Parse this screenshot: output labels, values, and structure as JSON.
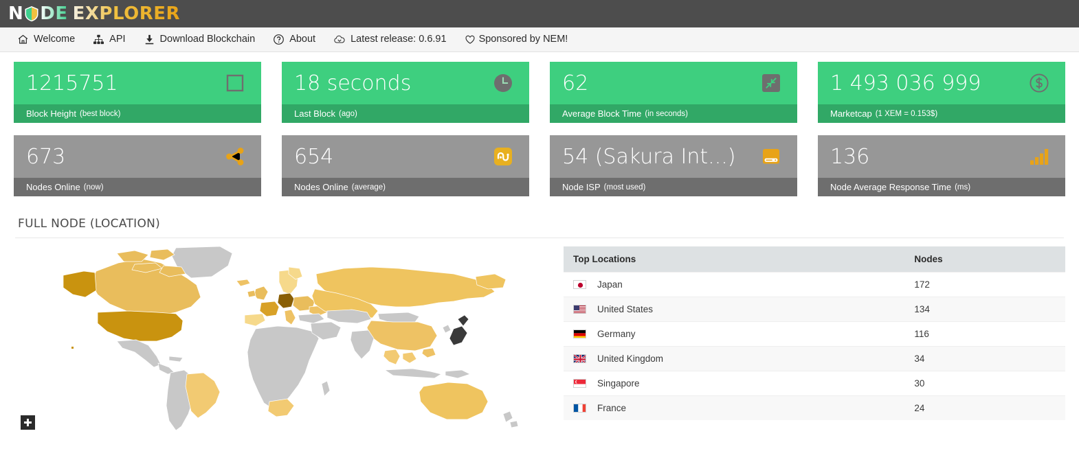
{
  "brand": {
    "part1": "N",
    "logo_icon": "nem-shield-icon",
    "part2": "DE",
    "part3": "EXPLORER"
  },
  "nav": {
    "items": [
      {
        "icon": "home-icon",
        "label": "Welcome"
      },
      {
        "icon": "sitemap-icon",
        "label": "API"
      },
      {
        "icon": "download-icon",
        "label": "Download Blockchain"
      },
      {
        "icon": "question-circle-icon",
        "label": "About"
      },
      {
        "icon": "cloud-download-icon",
        "label": "Latest release: 0.6.91"
      },
      {
        "icon": "heart-icon",
        "label": "Sponsored by NEM!"
      }
    ]
  },
  "colors": {
    "header_bg": "#4d4d4d",
    "nav_bg": "#f5f5f5",
    "green_body": "#3ecf7f",
    "green_footer": "#31a866",
    "gray_body": "#979797",
    "gray_footer": "#6e6e6e",
    "accent_gold": "#e8a317",
    "table_header_bg": "#dde1e3"
  },
  "cards": [
    {
      "value": "1215751",
      "label": "Block Height",
      "sub": "(best block)",
      "icon": "cube-icon",
      "theme": "green"
    },
    {
      "value": "18 seconds",
      "label": "Last Block",
      "sub": "(ago)",
      "icon": "clock-icon",
      "theme": "green"
    },
    {
      "value": "62",
      "label": "Average Block Time",
      "sub": "(in seconds)",
      "icon": "compress-icon",
      "theme": "green"
    },
    {
      "value": "1 493 036 999",
      "label": "Marketcap",
      "sub": "(1 XEM = 0.153$)",
      "icon": "dollar-icon",
      "theme": "green"
    },
    {
      "value": "673",
      "label": "Nodes Online",
      "sub": "(now)",
      "icon": "share-icon",
      "theme": "gray"
    },
    {
      "value": "654",
      "label": "Nodes Online",
      "sub": "(average)",
      "icon": "stumbleupon-icon",
      "theme": "gray"
    },
    {
      "value": "54 (Sakura Int...)",
      "label": "Node ISP",
      "sub": "(most used)",
      "icon": "hdd-icon",
      "theme": "gray"
    },
    {
      "value": "136",
      "label": "Node Average Response Time",
      "sub": "(ms)",
      "icon": "signal-bars-icon",
      "theme": "gray"
    }
  ],
  "section": {
    "title": "FULL NODE (LOCATION)"
  },
  "map": {
    "zoom_in_label": "+",
    "base_country_color": "#c8c8c8",
    "ocean_color": "#ffffff",
    "highlight_scale": [
      "#f6d98b",
      "#efc45f",
      "#e0a62a",
      "#b8800c",
      "#8a5f05"
    ]
  },
  "table": {
    "columns": [
      "Top Locations",
      "Nodes"
    ],
    "rows": [
      {
        "flag": "jp-flag-icon",
        "country": "Japan",
        "nodes": "172"
      },
      {
        "flag": "us-flag-icon",
        "country": "United States",
        "nodes": "134"
      },
      {
        "flag": "de-flag-icon",
        "country": "Germany",
        "nodes": "116"
      },
      {
        "flag": "gb-flag-icon",
        "country": "United Kingdom",
        "nodes": "34"
      },
      {
        "flag": "sg-flag-icon",
        "country": "Singapore",
        "nodes": "30"
      },
      {
        "flag": "fr-flag-icon",
        "country": "France",
        "nodes": "24"
      }
    ]
  }
}
